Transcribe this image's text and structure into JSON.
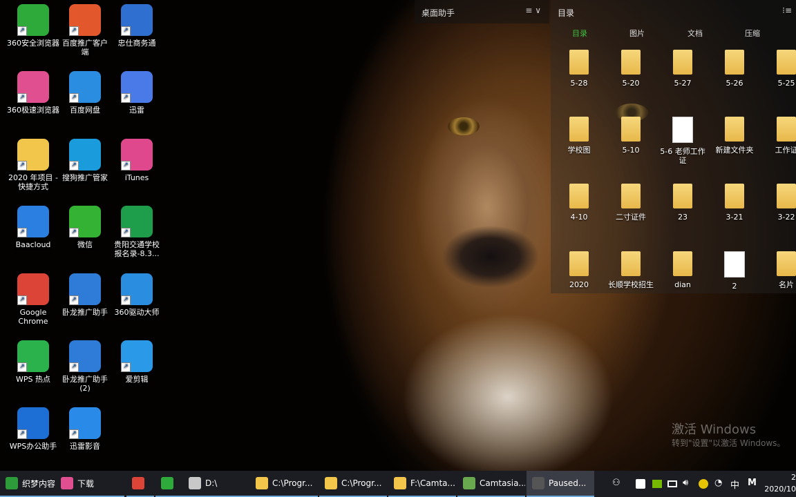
{
  "desktop_icons": [
    {
      "label": "360安全浏览器",
      "color": "#2eaa3a"
    },
    {
      "label": "百度推广客户端",
      "color": "#e2572c"
    },
    {
      "label": "忠仕商务通",
      "color": "#2f6fd0"
    },
    {
      "label": "360极速浏览器",
      "color": "#e05090"
    },
    {
      "label": "百度网盘",
      "color": "#2a8de0"
    },
    {
      "label": "迅雷",
      "color": "#4a7ae8"
    },
    {
      "label": "2020 年项目 - 快捷方式",
      "color": "#f2c64a"
    },
    {
      "label": "搜狗推广管家",
      "color": "#1a9bdb"
    },
    {
      "label": "iTunes",
      "color": "#e0488e"
    },
    {
      "label": "Baacloud",
      "color": "#2a7fe0"
    },
    {
      "label": "微信",
      "color": "#34b233"
    },
    {
      "label": "贵阳交通学校报名录-8.3...",
      "color": "#1e9e4a"
    },
    {
      "label": "Google Chrome",
      "color": "#db4437"
    },
    {
      "label": "卧龙推广助手",
      "color": "#2f7bd8"
    },
    {
      "label": "360驱动大师",
      "color": "#2a8de0"
    },
    {
      "label": "WPS 热点",
      "color": "#2bb24c"
    },
    {
      "label": "卧龙推广助手 (2)",
      "color": "#2f7bd8"
    },
    {
      "label": "爱剪辑",
      "color": "#2a9ae8"
    },
    {
      "label": "WPS办公助手",
      "color": "#1d6fd6"
    },
    {
      "label": "迅雷影音",
      "color": "#2a8ae8"
    }
  ],
  "fence_left": {
    "title": "桌面助手",
    "menu_icon": "≡ ∨"
  },
  "fence": {
    "title": "目录",
    "menu_icon": "⁝≡",
    "tabs": [
      {
        "label": "目录",
        "active": true
      },
      {
        "label": "图片",
        "active": false
      },
      {
        "label": "文档",
        "active": false
      },
      {
        "label": "压缩",
        "active": false
      }
    ],
    "items": [
      {
        "label": "5-28",
        "type": "folder"
      },
      {
        "label": "5-20",
        "type": "folder"
      },
      {
        "label": "5-27",
        "type": "folder"
      },
      {
        "label": "5-26",
        "type": "folder"
      },
      {
        "label": "5-25",
        "type": "folder"
      },
      {
        "label": "学校图",
        "type": "folder"
      },
      {
        "label": "5-10",
        "type": "folder"
      },
      {
        "label": "5-6 老师工作证",
        "type": "doc"
      },
      {
        "label": "新建文件夹",
        "type": "folder"
      },
      {
        "label": "工作证",
        "type": "folder"
      },
      {
        "label": "4-10",
        "type": "folder"
      },
      {
        "label": "二寸证件",
        "type": "folder"
      },
      {
        "label": "23",
        "type": "folder"
      },
      {
        "label": "3-21",
        "type": "folder"
      },
      {
        "label": "3-22",
        "type": "folder"
      },
      {
        "label": "2020",
        "type": "folder"
      },
      {
        "label": "长顺学校招生",
        "type": "folder"
      },
      {
        "label": "dian",
        "type": "folder"
      },
      {
        "label": "2",
        "type": "doc"
      },
      {
        "label": "名片",
        "type": "folder"
      }
    ]
  },
  "watermark": {
    "line1": "激活 Windows",
    "line2": "转到\"设置\"以激活 Windows。"
  },
  "taskbar": {
    "items": [
      {
        "label": "织梦内容...",
        "color": "#2e9b3a"
      },
      {
        "label": "下载",
        "color": "#e05090"
      },
      {
        "label": "",
        "color": "#db4437"
      },
      {
        "label": "",
        "color": "#2eaa3a"
      },
      {
        "label": "D:\\",
        "color": "#c8c8c8"
      },
      {
        "label": "C:\\Progr...",
        "color": "#f2c64a"
      },
      {
        "label": "C:\\Progr...",
        "color": "#f2c64a"
      },
      {
        "label": "F:\\Camta...",
        "color": "#f2c64a"
      },
      {
        "label": "Camtasia...",
        "color": "#6aa84f"
      },
      {
        "label": "Paused...",
        "color": "#555555"
      }
    ],
    "tray": {
      "people_icon": "⚇",
      "ime": "中",
      "m_icon": "M",
      "time": "2",
      "date": "2020/10"
    }
  }
}
